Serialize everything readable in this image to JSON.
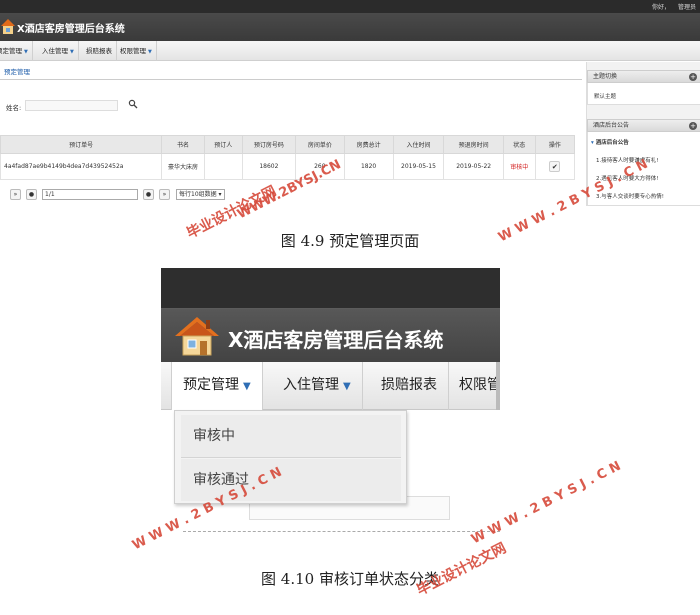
{
  "figure1": {
    "topbar": {
      "greeting": "你好，",
      "user": "管理员"
    },
    "app_title": "X酒店客房管理后台系统",
    "menu": [
      {
        "label": "预定管理"
      },
      {
        "label": "入住管理"
      },
      {
        "label": "损赔报表"
      },
      {
        "label": "权限管理"
      }
    ],
    "tab_label": "预定管理",
    "search": {
      "label": "姓名:",
      "value": ""
    },
    "table": {
      "headers": [
        "预订单号",
        "书名",
        "预订人",
        "预订房号码",
        "房间单价",
        "房费总计",
        "入住时间",
        "预退房时间",
        "状态",
        "操作"
      ],
      "rows": [
        [
          "4a4fad87ae9b4149b4dea7d43952452a",
          "豪华大床房",
          "",
          "18602",
          "260",
          "1820",
          "2019-05-15",
          "2019-05-22",
          "审核中",
          ""
        ]
      ]
    },
    "pager": {
      "page_value": "1/1",
      "page_size_label": "每行10组数据"
    },
    "sidebar": {
      "theme_header": "主题切换",
      "theme_item": "默认主题",
      "notice_header": "酒店后台公告",
      "notice_subheader": "酒店后台公告",
      "notices": [
        "1.接待客人时要谦虚有礼!",
        "2.遇见客人时要大方得体!",
        "3.与客人交谈时要专心热情!"
      ]
    }
  },
  "caption1": "图 4.9  预定管理页面",
  "figure2": {
    "app_title": "X酒店客房管理后台系统",
    "menu": [
      {
        "label": "预定管理"
      },
      {
        "label": "入住管理"
      },
      {
        "label": "损赔报表"
      },
      {
        "label": "权限管"
      }
    ],
    "dropdown": [
      "审核中",
      "审核通过"
    ]
  },
  "caption2": "图 4.10  审核订单状态分类",
  "watermarks": {
    "site": "WWW.2BYSJ.CN",
    "site_spaced": "W W W . 2 B Y S J . C N",
    "brand": "毕业设计论文网",
    "color": "#d64a3a"
  }
}
